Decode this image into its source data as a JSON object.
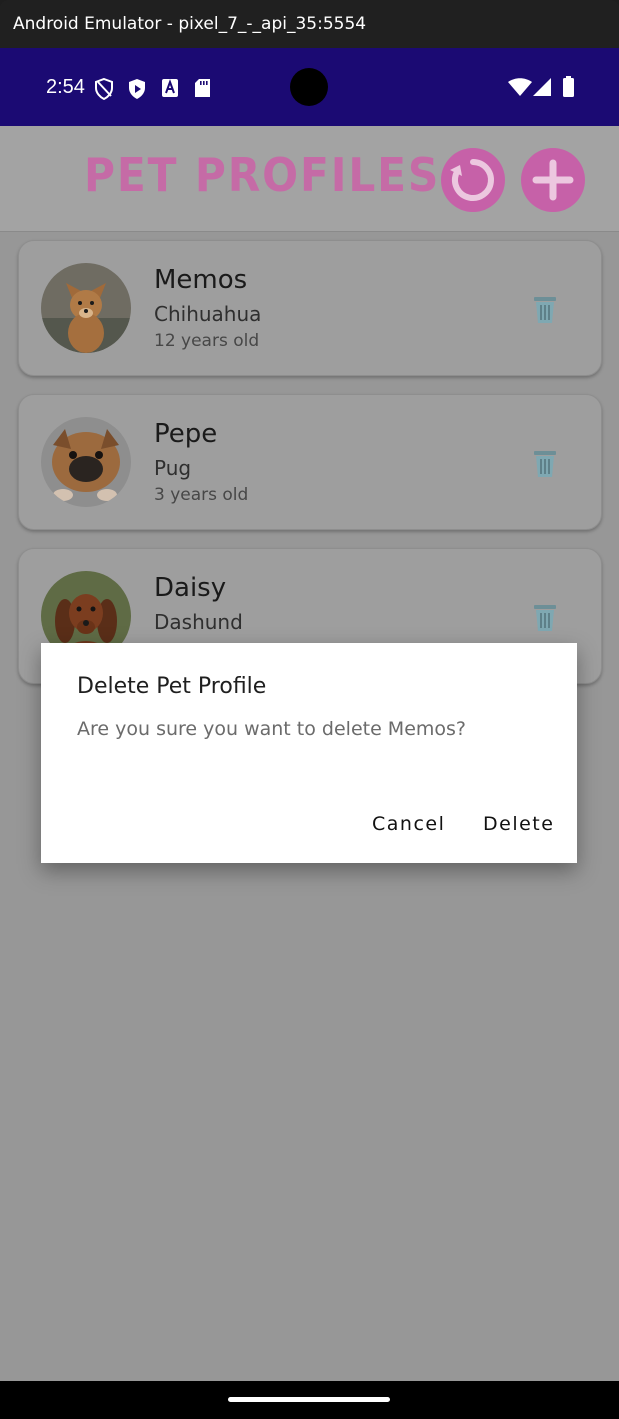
{
  "window": {
    "title": "Android Emulator - pixel_7_-_api_35:5554"
  },
  "status_bar": {
    "time": "2:54",
    "left_icons": [
      "shield-outline-icon",
      "play-protect-icon",
      "font-a-icon",
      "sd-card-icon"
    ],
    "right_icons": [
      "wifi-icon",
      "signal-icon",
      "battery-icon"
    ]
  },
  "app": {
    "title": "PET PROFILES",
    "accent_color": "#c661a8",
    "actions": {
      "refresh_icon": "refresh-icon",
      "add_icon": "plus-icon"
    }
  },
  "pets": [
    {
      "name": "Memos",
      "breed": "Chihuahua",
      "age": "12 years old"
    },
    {
      "name": "Pepe",
      "breed": "Pug",
      "age": "3 years old"
    },
    {
      "name": "Daisy",
      "breed": "Dashund",
      "age": ""
    }
  ],
  "dialog": {
    "title": "Delete Pet Profile",
    "message": "Are you sure you want to delete Memos?",
    "cancel_label": "Cancel",
    "confirm_label": "Delete"
  }
}
